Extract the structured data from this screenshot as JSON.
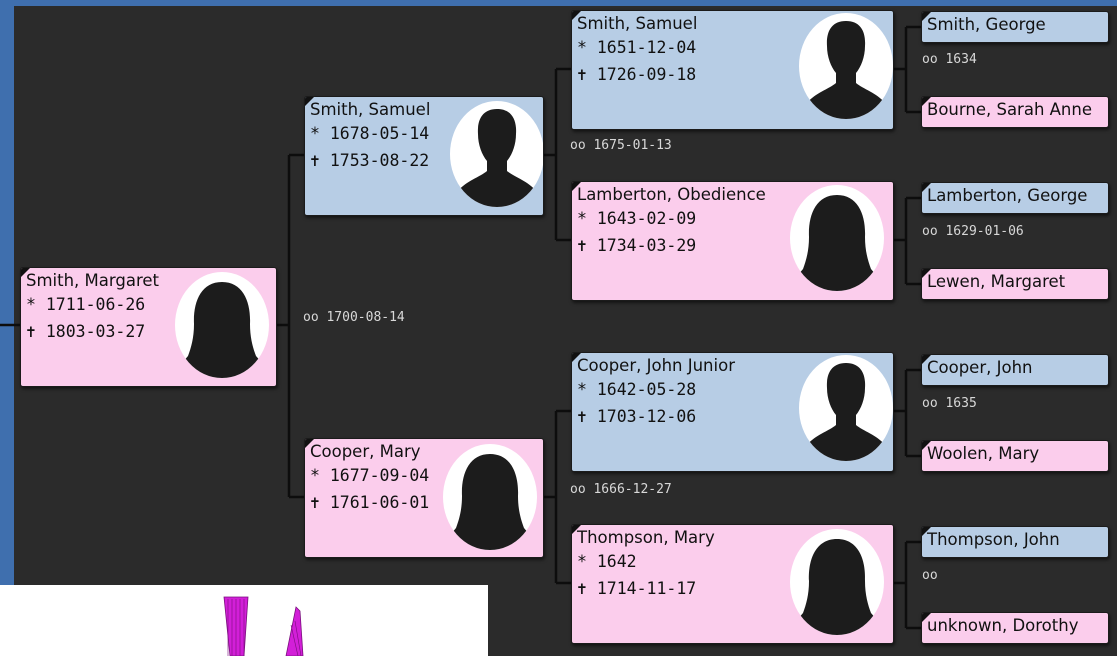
{
  "people": {
    "p1": {
      "name": "Smith, Margaret",
      "birth": "* 1711-06-26",
      "death": "✝ 1803-03-27",
      "gender": "female",
      "icon": "female-silhouette-icon"
    },
    "p2": {
      "name": "Smith, Samuel",
      "birth": "* 1678-05-14",
      "death": "✝ 1753-08-22",
      "gender": "male",
      "icon": "male-silhouette-icon"
    },
    "p3": {
      "name": "Cooper, Mary",
      "birth": "* 1677-09-04",
      "death": "✝ 1761-06-01",
      "gender": "female",
      "icon": "female-silhouette-icon"
    },
    "p4": {
      "name": "Smith, Samuel",
      "birth": "* 1651-12-04",
      "death": "✝ 1726-09-18",
      "gender": "male",
      "icon": "male-silhouette-icon"
    },
    "p5": {
      "name": "Lamberton, Obedience",
      "birth": "* 1643-02-09",
      "death": "✝ 1734-03-29",
      "gender": "female",
      "icon": "female-silhouette-icon"
    },
    "p6": {
      "name": "Cooper, John Junior",
      "birth": "* 1642-05-28",
      "death": "✝ 1703-12-06",
      "gender": "male",
      "icon": "male-silhouette-icon"
    },
    "p7": {
      "name": "Thompson, Mary",
      "birth": "* 1642",
      "death": "✝ 1714-11-17",
      "gender": "female",
      "icon": "female-silhouette-icon"
    },
    "p8": {
      "name": "Smith, George",
      "gender": "male"
    },
    "p9": {
      "name": "Bourne, Sarah Anne",
      "gender": "female"
    },
    "p10": {
      "name": "Lamberton, George",
      "gender": "male"
    },
    "p11": {
      "name": "Lewen, Margaret",
      "gender": "female"
    },
    "p12": {
      "name": "Cooper, John",
      "gender": "male"
    },
    "p13": {
      "name": "Woolen, Mary",
      "gender": "female"
    },
    "p14": {
      "name": "Thompson, John",
      "gender": "male"
    },
    "p15": {
      "name": "unknown, Dorothy",
      "gender": "female"
    }
  },
  "marriages": {
    "m1": "oo 1700-08-14",
    "m2": "oo 1675-01-13",
    "m3": "oo 1666-12-27",
    "m4": "oo 1634",
    "m5": "oo 1629-01-06",
    "m6": "oo 1635",
    "m7": "oo"
  },
  "colors": {
    "background": "#2b2b2b",
    "window_frame": "#3f6fae",
    "male_card": "#b7cde5",
    "female_card": "#fbcdec",
    "connector": "#0d0d0d",
    "marriage_text": "#d8d8d8",
    "overlay_accent": "#d21fd8"
  }
}
